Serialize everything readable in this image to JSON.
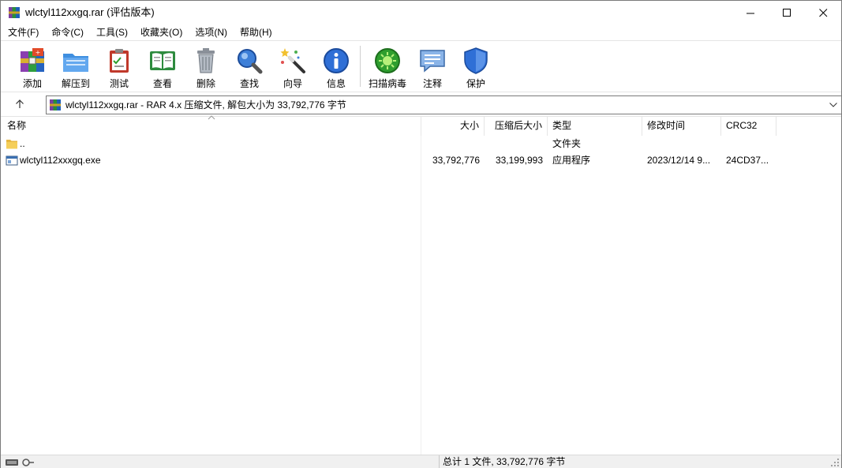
{
  "window": {
    "title": "wlctyl112xxgq.rar (评估版本)",
    "minimize_glyph": "—",
    "maximize_glyph": "☐",
    "close_glyph": "✕"
  },
  "menu": [
    {
      "label": "文件(F)"
    },
    {
      "label": "命令(C)"
    },
    {
      "label": "工具(S)"
    },
    {
      "label": "收藏夹(O)"
    },
    {
      "label": "选项(N)"
    },
    {
      "label": "帮助(H)"
    }
  ],
  "toolbar": {
    "add": "添加",
    "extract": "解压到",
    "test": "测试",
    "view": "查看",
    "delete": "删除",
    "find": "查找",
    "wizard": "向导",
    "info": "信息",
    "virus_scan": "扫描病毒",
    "comment": "注释",
    "protect": "保护"
  },
  "address": {
    "path": "wlctyl112xxgq.rar - RAR 4.x 压缩文件, 解包大小为 33,792,776 字节"
  },
  "columns": {
    "name": "名称",
    "size": "大小",
    "packed": "压缩后大小",
    "type": "类型",
    "modified": "修改时间",
    "crc": "CRC32"
  },
  "files": [
    {
      "name": "..",
      "size": "",
      "packed": "",
      "type": "文件夹",
      "modified": "",
      "crc": "",
      "icon": "folder-icon"
    },
    {
      "name": "wlctyl112xxxgq.exe",
      "size": "33,792,776",
      "packed": "33,199,993",
      "type": "应用程序",
      "modified": "2023/12/14 9...",
      "crc": "24CD37...",
      "icon": "exe-file-icon"
    }
  ],
  "status": {
    "summary": "总计 1 文件, 33,792,776 字节"
  },
  "colors": {
    "accent_green": "#2e9e2e",
    "shield_blue": "#2f6fd6",
    "folder_yellow": "#f5cf5a"
  }
}
